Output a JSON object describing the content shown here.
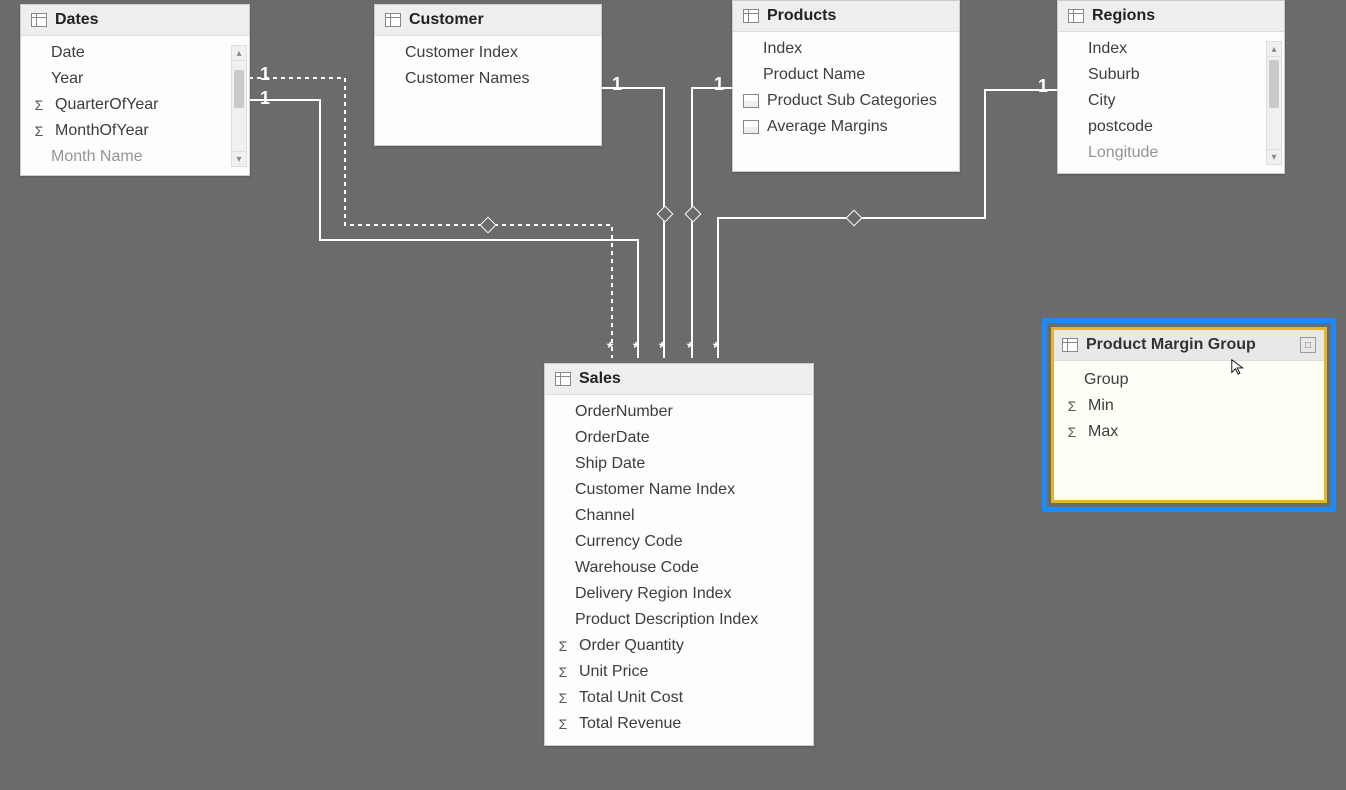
{
  "tables": {
    "dates": {
      "title": "Dates",
      "fields": [
        "Date",
        "Year",
        "QuarterOfYear",
        "MonthOfYear",
        "Month Name"
      ],
      "numeric": [
        false,
        false,
        true,
        true,
        false
      ]
    },
    "customer": {
      "title": "Customer",
      "fields": [
        "Customer Index",
        "Customer Names"
      ]
    },
    "products": {
      "title": "Products",
      "fields": [
        "Index",
        "Product Name",
        "Product Sub Categories",
        "Average Margins"
      ],
      "hier": [
        false,
        false,
        true,
        true
      ]
    },
    "regions": {
      "title": "Regions",
      "fields": [
        "Index",
        "Suburb",
        "City",
        "postcode",
        "Longitude"
      ]
    },
    "sales": {
      "title": "Sales",
      "fields": [
        "OrderNumber",
        "OrderDate",
        "Ship Date",
        "Customer Name Index",
        "Channel",
        "Currency Code",
        "Warehouse Code",
        "Delivery Region Index",
        "Product Description Index",
        "Order Quantity",
        "Unit Price",
        "Total Unit Cost",
        "Total Revenue"
      ],
      "numeric": [
        false,
        false,
        false,
        false,
        false,
        false,
        false,
        false,
        false,
        true,
        true,
        true,
        true
      ]
    },
    "pmg": {
      "title": "Product Margin Group",
      "fields": [
        "Group",
        "Min",
        "Max"
      ],
      "numeric": [
        false,
        true,
        true
      ]
    }
  },
  "relationships": {
    "one_labels": [
      "1",
      "1",
      "1",
      "1",
      "1"
    ],
    "many_symbol": "*"
  }
}
